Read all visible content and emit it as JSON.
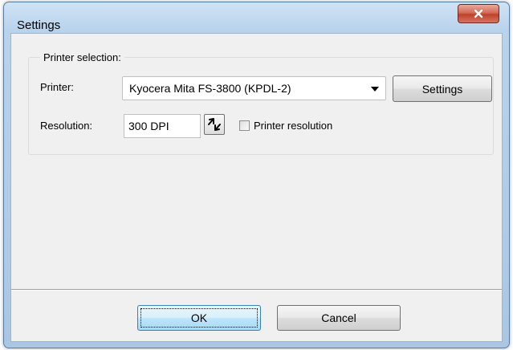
{
  "window": {
    "title": "Settings"
  },
  "group": {
    "legend": "Printer selection:",
    "printer_label": "Printer:",
    "printer_value": "Kyocera Mita FS-3800 (KPDL-2)",
    "settings_button": "Settings",
    "resolution_label": "Resolution:",
    "resolution_value": "300 DPI",
    "printer_resolution_label": "Printer resolution",
    "printer_resolution_checked": false
  },
  "footer": {
    "ok": "OK",
    "cancel": "Cancel"
  },
  "icons": {
    "close": "close-icon",
    "dropdown": "chevron-down-icon",
    "spinner": "updown-spinner-icon"
  },
  "colors": {
    "close_button": "#c8462f",
    "title_bar": "#b9d3ec",
    "ok_button": "#bee6fd"
  }
}
